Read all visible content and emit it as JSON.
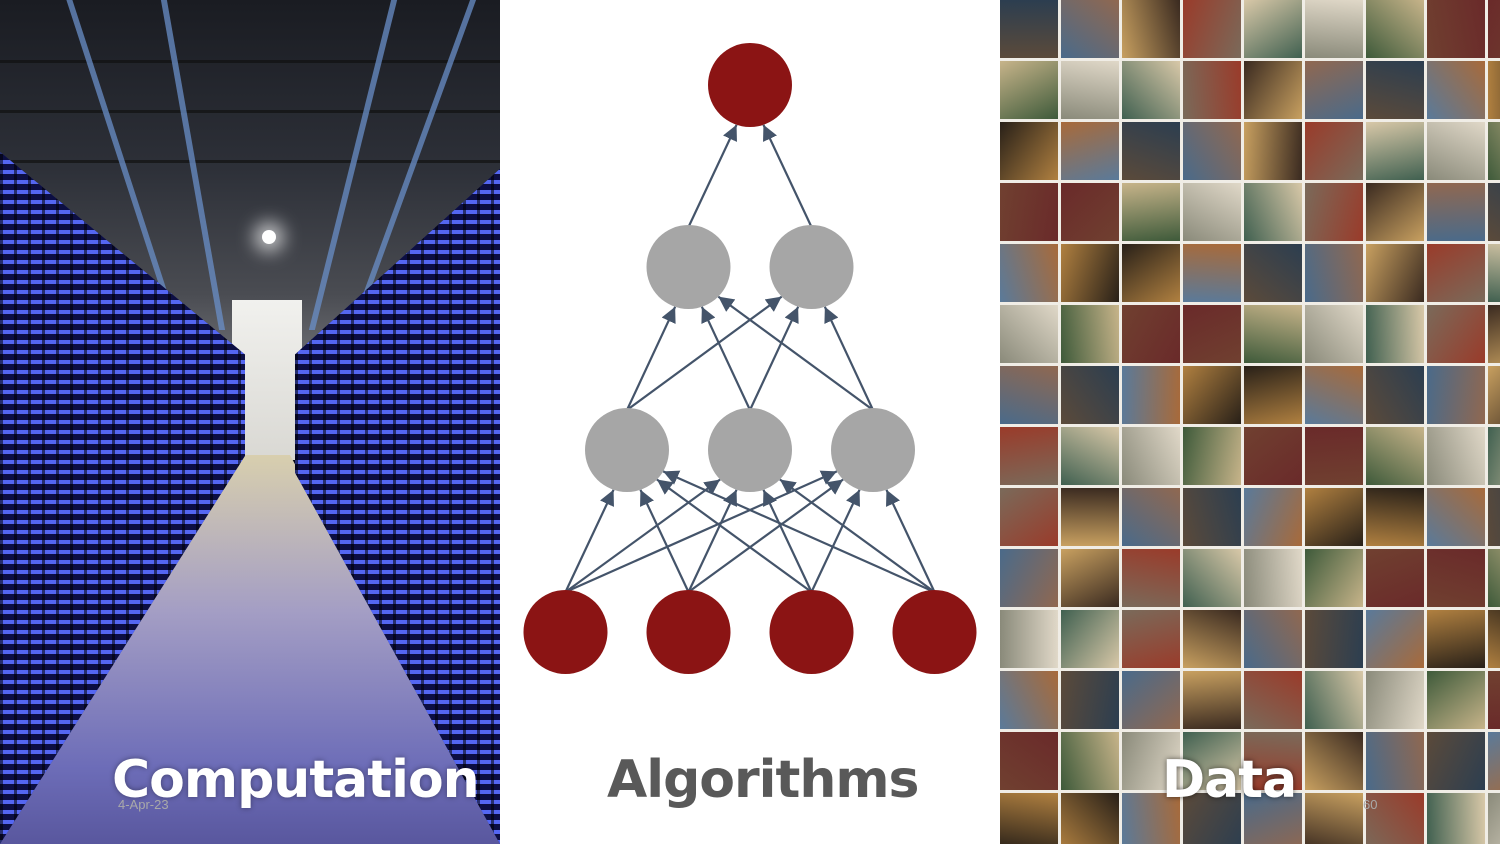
{
  "panels": {
    "computation": {
      "label": "Computation"
    },
    "algorithms": {
      "label": "Algorithms"
    },
    "data": {
      "label": "Data"
    }
  },
  "footer": {
    "date": "4-Apr-23",
    "page_number": "60"
  },
  "network": {
    "layers": [
      4,
      3,
      2,
      1
    ],
    "colors": {
      "input": "#8b1414",
      "hidden": "#a6a6a6",
      "output": "#8b1414",
      "edge": "#44546a"
    }
  },
  "colors": {
    "computation_label": "#ffffff",
    "algorithms_label": "#595959",
    "data_label": "#ffffff"
  }
}
